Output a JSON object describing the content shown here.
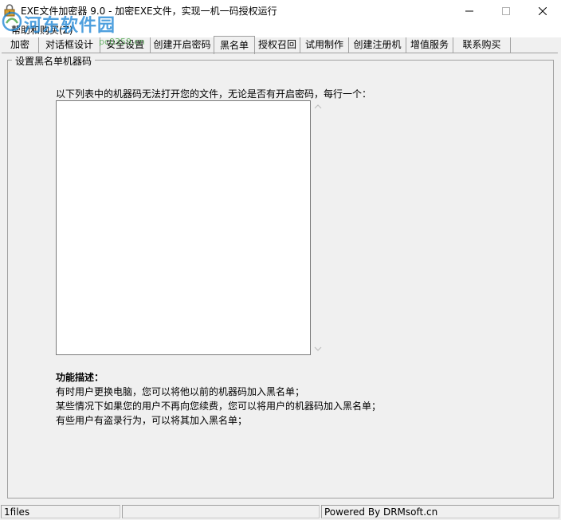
{
  "window": {
    "title": "EXE文件加密器 9.0 - 加密EXE文件，实现一机一码授权运行"
  },
  "menu": {
    "items": [
      "帮助和购买(Z)"
    ]
  },
  "watermark": {
    "text": "河东软件园",
    "sub": "pc0359.cn"
  },
  "tabs": [
    {
      "label": "加密"
    },
    {
      "label": "对话框设计"
    },
    {
      "label": "安全设置"
    },
    {
      "label": "创建开启密码"
    },
    {
      "label": "黑名单"
    },
    {
      "label": "授权召回"
    },
    {
      "label": "试用制作"
    },
    {
      "label": "创建注册机"
    },
    {
      "label": "增值服务"
    },
    {
      "label": "联系购买"
    }
  ],
  "active_tab": "黑名单",
  "group": {
    "title": "设置黑名单机器码"
  },
  "content": {
    "instruction": "以下列表中的机器码无法打开您的文件，无论是否有开启密码，每行一个：",
    "blacklist_value": "",
    "description": {
      "heading": "功能描述：",
      "lines": [
        "有时用户更换电脑，您可以将他以前的机器码加入黑名单；",
        "某些情况下如果您的用户不再向您续费，您可以将用户的机器码加入黑名单；",
        "有些用户有盗录行为，可以将其加入黑名单；"
      ]
    }
  },
  "status": {
    "files": "1files",
    "middle": "",
    "powered": "Powered By DRMsoft.cn"
  },
  "colors": {
    "watermark": "#1e86d6",
    "background": "#f0f0f0",
    "border": "#a0a0a0"
  }
}
